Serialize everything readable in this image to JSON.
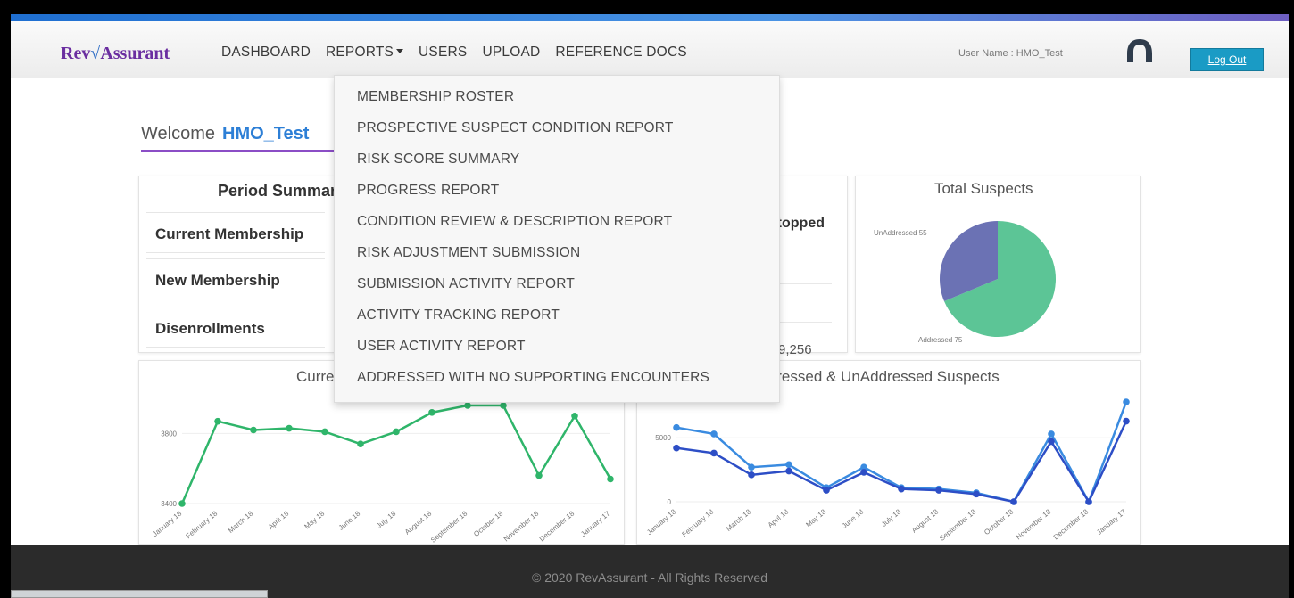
{
  "app": {
    "logo_part1": "Rev",
    "logo_part2": "Assurant"
  },
  "nav": {
    "items": [
      "DASHBOARD",
      "REPORTS",
      "USERS",
      "UPLOAD",
      "REFERENCE DOCS"
    ]
  },
  "header": {
    "user_label": "User Name : HMO_Test",
    "logout": "Log Out"
  },
  "welcome": {
    "prefix": "Welcome",
    "name": "HMO_Test"
  },
  "period": {
    "title": "Period Summary",
    "rows": [
      "Current Membership",
      "New Membership",
      "Disenrollments"
    ],
    "stopped": "Stopped",
    "value": "9,256"
  },
  "total_suspects": {
    "title": "Total Suspects",
    "labels": [
      "UnAddressed 55",
      "Addressed 75"
    ]
  },
  "charts": {
    "left_title": "Current",
    "right_title": "Addressed & UnAddressed Suspects"
  },
  "reports_menu": [
    "MEMBERSHIP ROSTER",
    "PROSPECTIVE SUSPECT CONDITION REPORT",
    "RISK SCORE SUMMARY",
    "PROGRESS REPORT",
    "CONDITION REVIEW & DESCRIPTION REPORT",
    "RISK ADJUSTMENT SUBMISSION",
    "SUBMISSION ACTIVITY REPORT",
    "ACTIVITY TRACKING REPORT",
    "USER ACTIVITY REPORT",
    "ADDRESSED WITH NO SUPPORTING ENCOUNTERS"
  ],
  "footer": "© 2020 RevAssurant - All Rights Reserved",
  "colors": {
    "accent": "#1a9bc5",
    "purple": "#6a2ea0",
    "green": "#2fb56a",
    "blue": "#2d4ec6"
  },
  "chart_data": [
    {
      "type": "line",
      "title": "Current",
      "x": [
        "January 18",
        "February 18",
        "March 18",
        "April 18",
        "May 18",
        "June 18",
        "July 18",
        "August 18",
        "September 18",
        "October 18",
        "November 18",
        "December 18",
        "January 17"
      ],
      "series": [
        {
          "values": [
            3400,
            3870,
            3820,
            3830,
            3810,
            3740,
            3810,
            3920,
            3960,
            3960,
            3560,
            3900,
            3540
          ]
        }
      ],
      "yticks": [
        "3800",
        "3400"
      ],
      "ylim": [
        3400,
        3960
      ]
    },
    {
      "type": "line",
      "title": "Addressed & UnAddressed Suspects",
      "x": [
        "January 18",
        "February 18",
        "March 18",
        "April 18",
        "May 18",
        "June 18",
        "July 18",
        "August 18",
        "September 18",
        "October 18",
        "November 18",
        "December 18",
        "January 17"
      ],
      "series": [
        {
          "values": [
            5800,
            5300,
            2700,
            2900,
            1100,
            2700,
            1100,
            1000,
            700,
            0,
            5300,
            0,
            7800
          ]
        },
        {
          "values": [
            4200,
            3800,
            2100,
            2400,
            900,
            2300,
            1000,
            900,
            600,
            0,
            4700,
            0,
            6300
          ]
        }
      ],
      "yticks": [
        "5000",
        "0"
      ],
      "ylim": [
        0,
        7800
      ]
    },
    {
      "type": "pie",
      "title": "Total Suspects",
      "labels": [
        "UnAddressed 55",
        "Addressed 75"
      ],
      "values": [
        55,
        75
      ]
    }
  ]
}
